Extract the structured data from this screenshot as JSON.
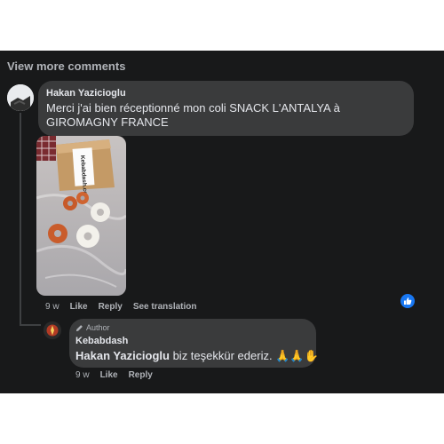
{
  "view_more_label": "View more comments",
  "comments": [
    {
      "author": "Hakan Yazicioglu",
      "text": "Merci j'ai bien réceptionné mon coli SNACK L'ANTALYA à GIROMAGNY FRANCE",
      "photo_box_text": "Kebabdash.com",
      "actions": {
        "time": "9 w",
        "like": "Like",
        "reply": "Reply",
        "translate": "See translation"
      },
      "reaction_icon": "thumbs-up-icon"
    },
    {
      "author_badge": "Author",
      "author": "Kebabdash",
      "mention": "Hakan Yazicioglu",
      "text": " biz teşekkür ederiz. 🙏🙏✋",
      "actions": {
        "time": "9 w",
        "like": "Like",
        "reply": "Reply"
      }
    }
  ],
  "colors": {
    "background": "#18191a",
    "bubble": "#3a3b3c",
    "text": "#e4e6eb",
    "muted": "#b0b3b8",
    "reaction_blue": "#1877f2"
  }
}
